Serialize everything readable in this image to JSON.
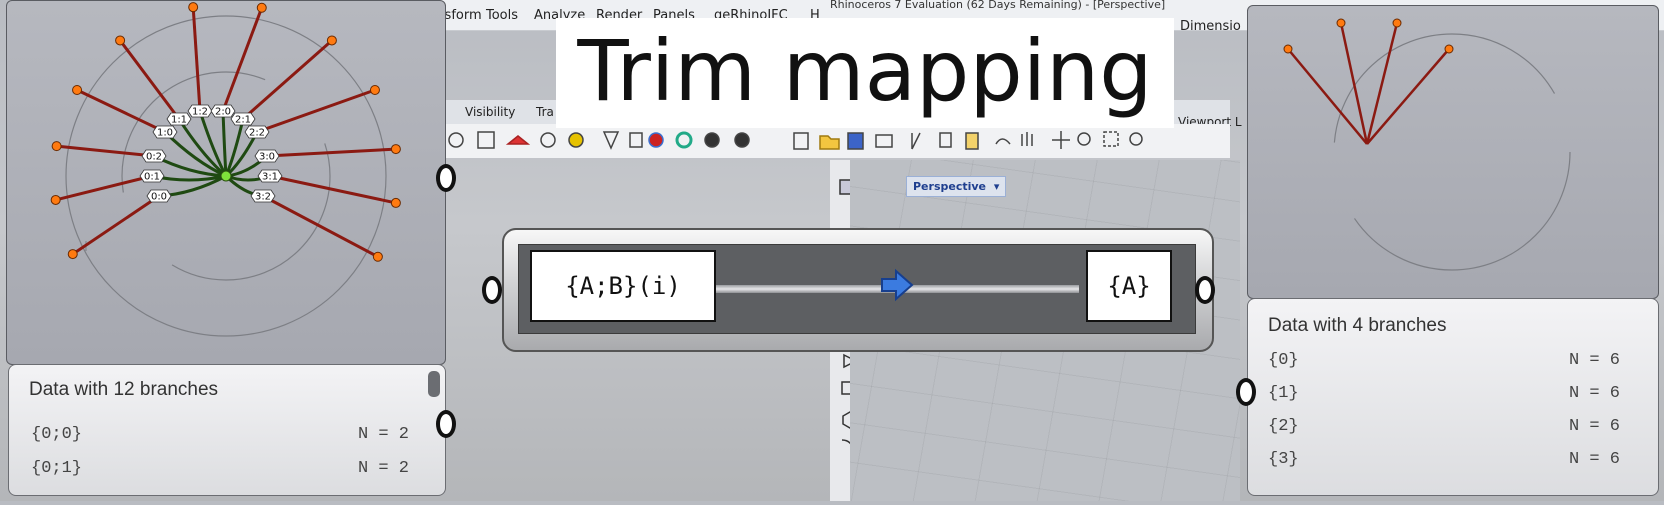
{
  "title_overlay": "Trim mapping",
  "rhino": {
    "window_title": "Rhinoceros 7 Evaluation (62 Days Remaining) - [Perspective]",
    "menu_items": [
      "ransform",
      "Tools",
      "Analyze",
      "Render",
      "Panels",
      "geRhinoIFC",
      "H"
    ],
    "menu_right": "Dimensio",
    "tabs": [
      "Visibility",
      "Tra",
      "Viewport L"
    ],
    "viewport_tab": "Perspective"
  },
  "trim_component": {
    "input_label": "{A;B}(i)",
    "output_label": "{A}",
    "arrow_icon": "arrow-right-icon",
    "accent": "#2f6fd6"
  },
  "left_graph": {
    "branch_labels": [
      "0:0",
      "0:1",
      "0:2",
      "1:0",
      "1:1",
      "1:2",
      "2:0",
      "2:1",
      "2:2",
      "3:0",
      "3:1",
      "3:2"
    ],
    "colors": {
      "branch": "#8b1a12",
      "root_line": "#1f4a12",
      "endpoint": "#ff7a10",
      "root": "#7fe23b"
    }
  },
  "left_panel": {
    "title": "Data with 12 branches",
    "rows": [
      {
        "key": "{0;0}",
        "value": "N = 2"
      },
      {
        "key": "{0;1}",
        "value": "N = 2"
      }
    ]
  },
  "right_panel": {
    "title": "Data with 4 branches",
    "rows": [
      {
        "key": "{0}",
        "value": "N = 6"
      },
      {
        "key": "{1}",
        "value": "N = 6"
      },
      {
        "key": "{2}",
        "value": "N = 6"
      },
      {
        "key": "{3}",
        "value": "N = 6"
      }
    ]
  }
}
